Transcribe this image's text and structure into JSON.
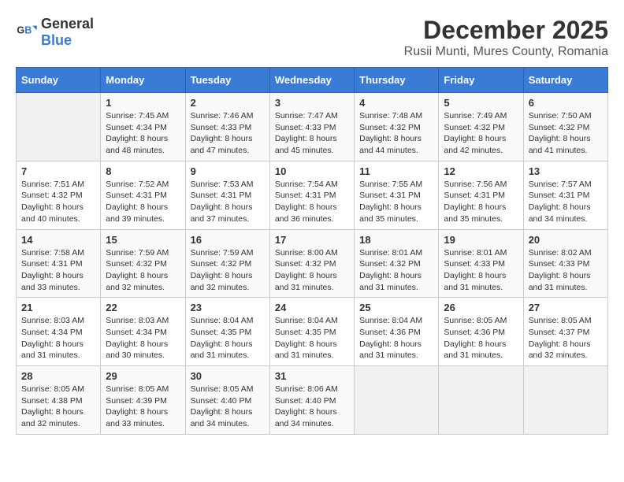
{
  "header": {
    "logo_general": "General",
    "logo_blue": "Blue",
    "title": "December 2025",
    "subtitle": "Rusii Munti, Mures County, Romania"
  },
  "calendar": {
    "days_of_week": [
      "Sunday",
      "Monday",
      "Tuesday",
      "Wednesday",
      "Thursday",
      "Friday",
      "Saturday"
    ],
    "weeks": [
      [
        {
          "day": "",
          "info": ""
        },
        {
          "day": "1",
          "info": "Sunrise: 7:45 AM\nSunset: 4:34 PM\nDaylight: 8 hours\nand 48 minutes."
        },
        {
          "day": "2",
          "info": "Sunrise: 7:46 AM\nSunset: 4:33 PM\nDaylight: 8 hours\nand 47 minutes."
        },
        {
          "day": "3",
          "info": "Sunrise: 7:47 AM\nSunset: 4:33 PM\nDaylight: 8 hours\nand 45 minutes."
        },
        {
          "day": "4",
          "info": "Sunrise: 7:48 AM\nSunset: 4:32 PM\nDaylight: 8 hours\nand 44 minutes."
        },
        {
          "day": "5",
          "info": "Sunrise: 7:49 AM\nSunset: 4:32 PM\nDaylight: 8 hours\nand 42 minutes."
        },
        {
          "day": "6",
          "info": "Sunrise: 7:50 AM\nSunset: 4:32 PM\nDaylight: 8 hours\nand 41 minutes."
        }
      ],
      [
        {
          "day": "7",
          "info": "Sunrise: 7:51 AM\nSunset: 4:32 PM\nDaylight: 8 hours\nand 40 minutes."
        },
        {
          "day": "8",
          "info": "Sunrise: 7:52 AM\nSunset: 4:31 PM\nDaylight: 8 hours\nand 39 minutes."
        },
        {
          "day": "9",
          "info": "Sunrise: 7:53 AM\nSunset: 4:31 PM\nDaylight: 8 hours\nand 37 minutes."
        },
        {
          "day": "10",
          "info": "Sunrise: 7:54 AM\nSunset: 4:31 PM\nDaylight: 8 hours\nand 36 minutes."
        },
        {
          "day": "11",
          "info": "Sunrise: 7:55 AM\nSunset: 4:31 PM\nDaylight: 8 hours\nand 35 minutes."
        },
        {
          "day": "12",
          "info": "Sunrise: 7:56 AM\nSunset: 4:31 PM\nDaylight: 8 hours\nand 35 minutes."
        },
        {
          "day": "13",
          "info": "Sunrise: 7:57 AM\nSunset: 4:31 PM\nDaylight: 8 hours\nand 34 minutes."
        }
      ],
      [
        {
          "day": "14",
          "info": "Sunrise: 7:58 AM\nSunset: 4:31 PM\nDaylight: 8 hours\nand 33 minutes."
        },
        {
          "day": "15",
          "info": "Sunrise: 7:59 AM\nSunset: 4:32 PM\nDaylight: 8 hours\nand 32 minutes."
        },
        {
          "day": "16",
          "info": "Sunrise: 7:59 AM\nSunset: 4:32 PM\nDaylight: 8 hours\nand 32 minutes."
        },
        {
          "day": "17",
          "info": "Sunrise: 8:00 AM\nSunset: 4:32 PM\nDaylight: 8 hours\nand 31 minutes."
        },
        {
          "day": "18",
          "info": "Sunrise: 8:01 AM\nSunset: 4:32 PM\nDaylight: 8 hours\nand 31 minutes."
        },
        {
          "day": "19",
          "info": "Sunrise: 8:01 AM\nSunset: 4:33 PM\nDaylight: 8 hours\nand 31 minutes."
        },
        {
          "day": "20",
          "info": "Sunrise: 8:02 AM\nSunset: 4:33 PM\nDaylight: 8 hours\nand 31 minutes."
        }
      ],
      [
        {
          "day": "21",
          "info": "Sunrise: 8:03 AM\nSunset: 4:34 PM\nDaylight: 8 hours\nand 31 minutes."
        },
        {
          "day": "22",
          "info": "Sunrise: 8:03 AM\nSunset: 4:34 PM\nDaylight: 8 hours\nand 30 minutes."
        },
        {
          "day": "23",
          "info": "Sunrise: 8:04 AM\nSunset: 4:35 PM\nDaylight: 8 hours\nand 31 minutes."
        },
        {
          "day": "24",
          "info": "Sunrise: 8:04 AM\nSunset: 4:35 PM\nDaylight: 8 hours\nand 31 minutes."
        },
        {
          "day": "25",
          "info": "Sunrise: 8:04 AM\nSunset: 4:36 PM\nDaylight: 8 hours\nand 31 minutes."
        },
        {
          "day": "26",
          "info": "Sunrise: 8:05 AM\nSunset: 4:36 PM\nDaylight: 8 hours\nand 31 minutes."
        },
        {
          "day": "27",
          "info": "Sunrise: 8:05 AM\nSunset: 4:37 PM\nDaylight: 8 hours\nand 32 minutes."
        }
      ],
      [
        {
          "day": "28",
          "info": "Sunrise: 8:05 AM\nSunset: 4:38 PM\nDaylight: 8 hours\nand 32 minutes."
        },
        {
          "day": "29",
          "info": "Sunrise: 8:05 AM\nSunset: 4:39 PM\nDaylight: 8 hours\nand 33 minutes."
        },
        {
          "day": "30",
          "info": "Sunrise: 8:05 AM\nSunset: 4:40 PM\nDaylight: 8 hours\nand 34 minutes."
        },
        {
          "day": "31",
          "info": "Sunrise: 8:06 AM\nSunset: 4:40 PM\nDaylight: 8 hours\nand 34 minutes."
        },
        {
          "day": "",
          "info": ""
        },
        {
          "day": "",
          "info": ""
        },
        {
          "day": "",
          "info": ""
        }
      ]
    ]
  }
}
